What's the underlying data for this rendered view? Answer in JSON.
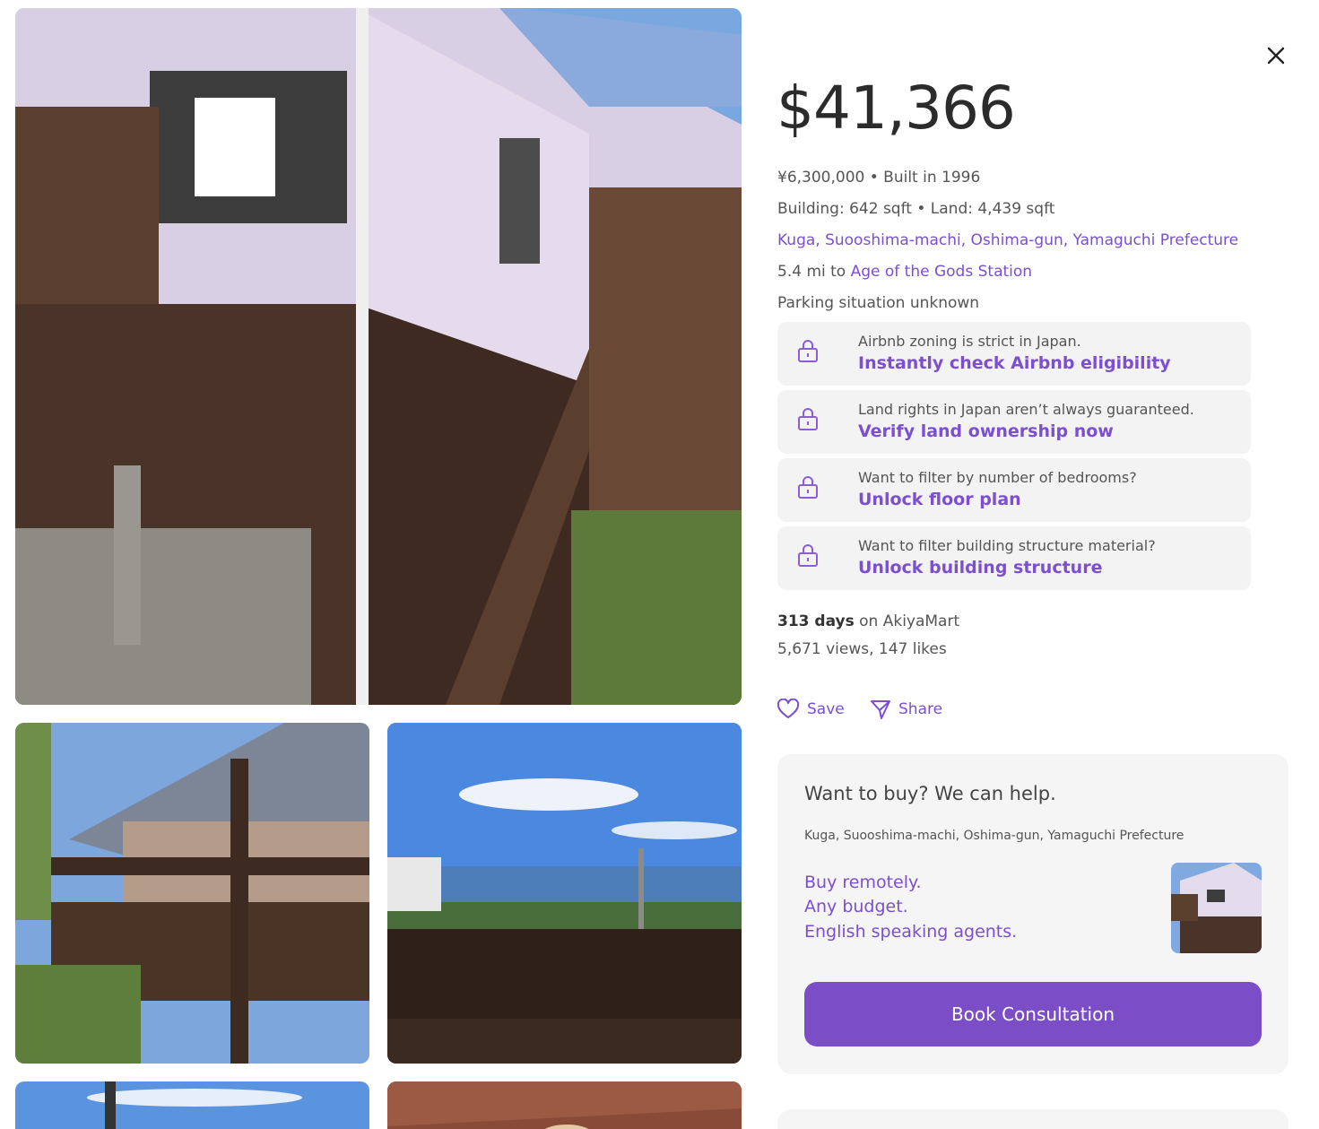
{
  "listing": {
    "price_usd": "$41,366",
    "price_yen_built": "¥6,300,000 • Built in 1996",
    "size": "Building: 642 sqft • Land: 4,439 sqft",
    "location": "Kuga, Suooshima-machi, Oshima-gun, Yamaguchi Prefecture",
    "station_prefix": "5.4 mi to ",
    "station_name": "Age of the Gods Station",
    "parking": "Parking situation unknown"
  },
  "locked_features": [
    {
      "message": "Airbnb zoning is strict in Japan.",
      "cta": "Instantly check Airbnb eligibility",
      "icon": "lock-icon"
    },
    {
      "message": "Land rights in Japan aren’t always guaranteed.",
      "cta": "Verify land ownership now",
      "icon": "lock-icon"
    },
    {
      "message": "Want to filter by number of bedrooms?",
      "cta": "Unlock floor plan",
      "icon": "lock-icon"
    },
    {
      "message": "Want to filter building structure material?",
      "cta": "Unlock building structure",
      "icon": "lock-icon"
    }
  ],
  "stats": {
    "days": "313 days",
    "days_suffix": " on AkiyaMart",
    "views_likes": "5,671 views, 147 likes"
  },
  "actions": {
    "save_label": "Save",
    "share_label": "Share"
  },
  "consult": {
    "heading": "Want to buy? We can help.",
    "address": "Kuga, Suooshima-machi, Oshima-gun, Yamaguchi Prefecture",
    "pitch": [
      "Buy remotely.",
      "Any budget.",
      "English speaking agents."
    ],
    "button_label": "Book Consultation"
  },
  "colors": {
    "accent": "#7b4fd0",
    "button": "#7b4ec8",
    "card_bg": "#f3f3f3"
  },
  "icons": {
    "close": "close-icon",
    "save": "heart-icon",
    "share": "send-icon"
  }
}
